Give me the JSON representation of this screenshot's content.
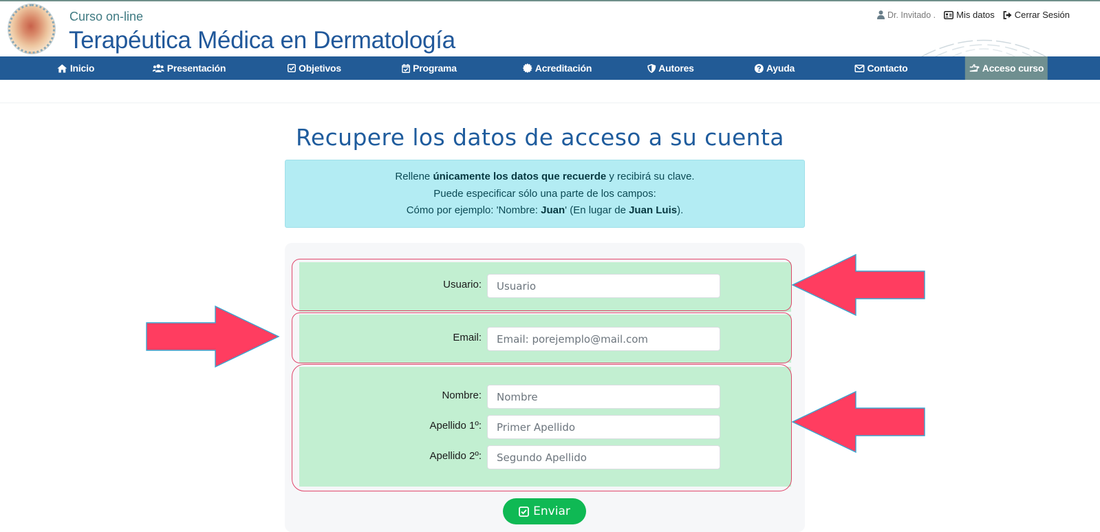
{
  "header": {
    "subtitle": "Curso on-line",
    "title": "Terapéutica Médica en Dermatología",
    "user": {
      "name": "Dr. Invitado .",
      "my_data": "Mis datos",
      "logout": "Cerrar Sesión"
    }
  },
  "nav": [
    {
      "label": "Inicio",
      "icon": "home-icon"
    },
    {
      "label": "Presentación",
      "icon": "users-icon"
    },
    {
      "label": "Objetivos",
      "icon": "check-square-icon"
    },
    {
      "label": "Programa",
      "icon": "calendar-check-icon"
    },
    {
      "label": "Acreditación",
      "icon": "certificate-icon"
    },
    {
      "label": "Autores",
      "icon": "shield-icon"
    },
    {
      "label": "Ayuda",
      "icon": "question-circle-icon"
    },
    {
      "label": "Contacto",
      "icon": "envelope-icon"
    },
    {
      "label": "Acceso curso",
      "icon": "hand-point-icon",
      "active": true
    }
  ],
  "main": {
    "title": "Recupere los datos de acceso a su cuenta",
    "info": {
      "line1_pre": "Rellene ",
      "line1_bold": "únicamente los datos que recuerde",
      "line1_post": " y recibirá su clave.",
      "line2": "Puede especificar sólo una parte de los campos:",
      "line3_pre": "Cómo por ejemplo: 'Nombre: ",
      "line3_bold1": "Juan",
      "line3_mid": "' (En lugar de ",
      "line3_bold2": "Juan Luis",
      "line3_post": ")."
    },
    "form": {
      "usuario": {
        "label": "Usuario:",
        "placeholder": "Usuario",
        "value": ""
      },
      "email": {
        "label": "Email:",
        "placeholder": "Email: porejemplo@mail.com",
        "value": ""
      },
      "nombre": {
        "label": "Nombre:",
        "placeholder": "Nombre",
        "value": ""
      },
      "apellido1": {
        "label": "Apellido 1º:",
        "placeholder": "Primer Apellido",
        "value": ""
      },
      "apellido2": {
        "label": "Apellido 2º:",
        "placeholder": "Segundo Apellido",
        "value": ""
      },
      "submit_label": "Enviar"
    }
  },
  "colors": {
    "nav_bg": "#225b96",
    "title_blue": "#1f5c9d",
    "info_bg": "#b3ecf3",
    "group_bg": "#c2efd1",
    "submit_bg": "#0fb954",
    "annotation_arrow": "#ff3d60",
    "annotation_outline": "#e0466b"
  }
}
